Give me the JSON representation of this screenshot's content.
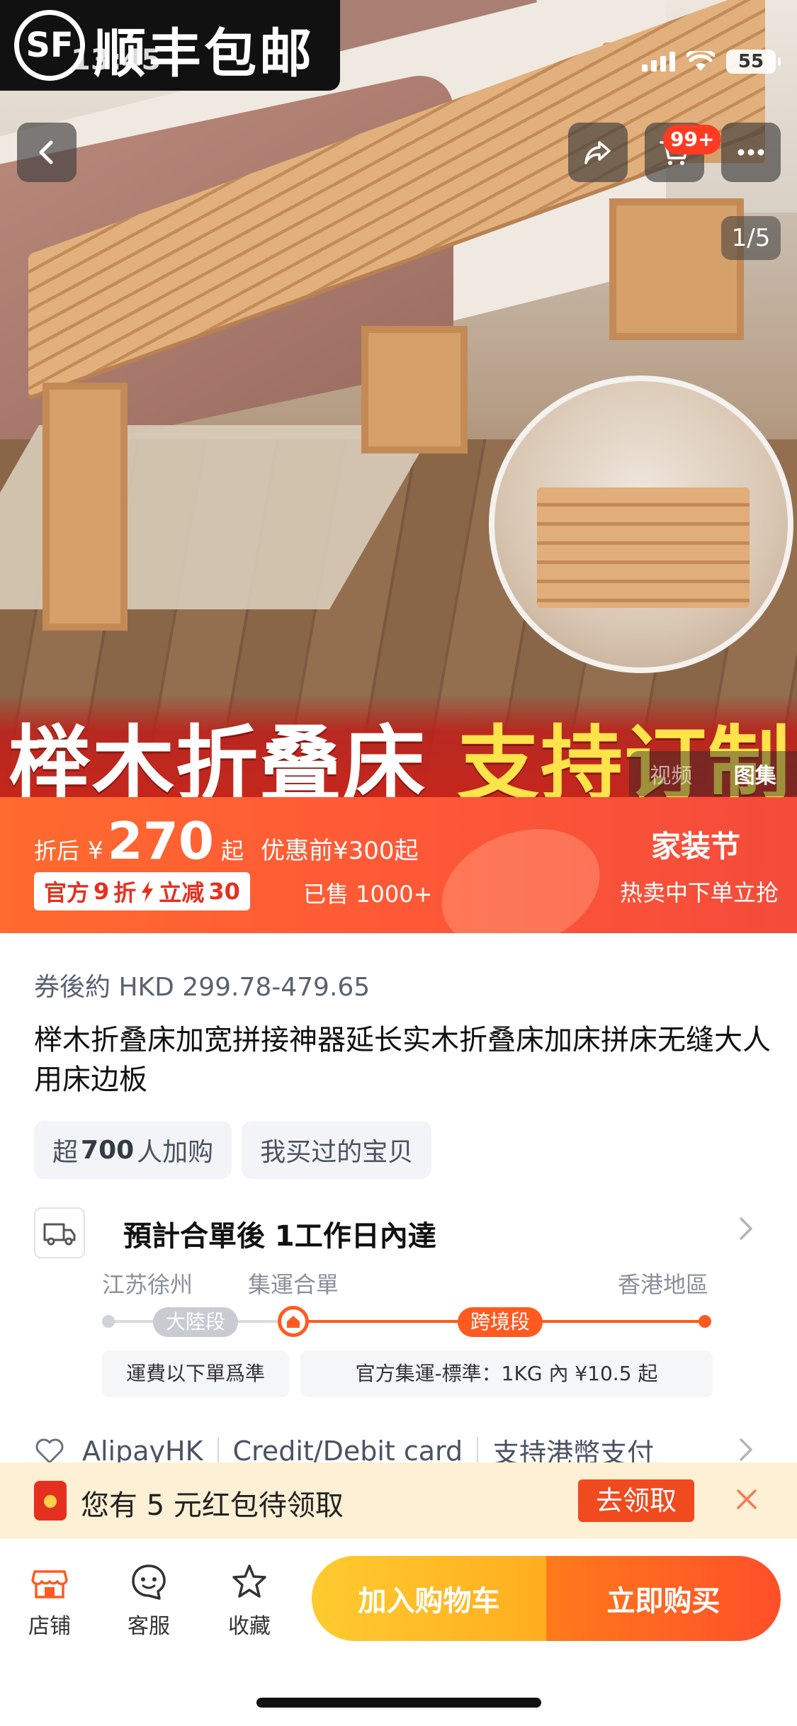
{
  "status_bar": {
    "logo_badge": "SF",
    "logo_text": "顺丰包邮",
    "time": "13:45",
    "battery": "55"
  },
  "hero": {
    "banner_left": "榉木折叠床",
    "banner_right": "支持订制",
    "image_counter": "1/5",
    "media_tabs": [
      "视频",
      "图集"
    ],
    "active_media_tab": "图集"
  },
  "header": {
    "cart_badge": "99+"
  },
  "price": {
    "prefix": "折后",
    "currency": "¥",
    "amount": "270",
    "suffix": "起",
    "before": "优惠前¥300起",
    "promo_a": "官方",
    "promo_discount": "9",
    "promo_b": "折",
    "promo_c": "立减",
    "promo_amount": "30",
    "sold": "已售 1000+",
    "festival": "家装节",
    "festival_sub": "热卖中下单立抢"
  },
  "product": {
    "coupon_price": "券後約 HKD 299.78-479.65",
    "title": "榉木折叠床加宽拼接神器延长实木折叠床加床拼床无缝大人用床边板",
    "tag1_pre": "超",
    "tag1_num": "700",
    "tag1_post": "人加购",
    "tag2": "我买过的宝贝"
  },
  "delivery": {
    "title": "預計合單後 1工作日內達",
    "origin": "江苏徐州",
    "hub": "集運合單",
    "destination": "香港地區",
    "segment_mainland": "大陸段",
    "segment_cross": "跨境段",
    "note_mainland": "運費以下單爲準",
    "note_cross": "官方集運-標準：1KG 內 ¥10.5 起"
  },
  "payment": {
    "method1": "AlipayHK",
    "method2": "Credit/Debit card",
    "method3": "支持港幣支付"
  },
  "red_packet": {
    "text": "您有 5 元红包待领取",
    "claim": "去领取"
  },
  "bottom_nav": {
    "shop": "店铺",
    "service": "客服",
    "favorite": "收藏",
    "add_to_cart": "加入购物车",
    "buy_now": "立即购买"
  },
  "colors": {
    "accent": "#ff5a1f",
    "price_bar": "#f44b3b",
    "cart_button": "#ffb71f",
    "buy_button": "#ff4f2a",
    "red_packet_bg": "#fdf0d4"
  }
}
